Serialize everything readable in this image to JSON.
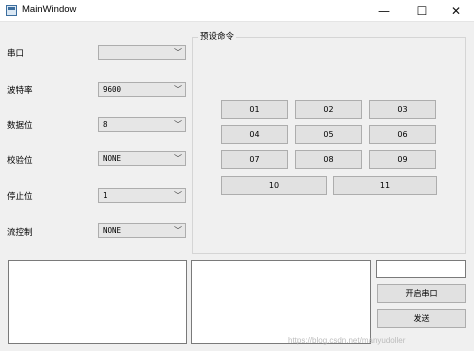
{
  "window": {
    "title": "MainWindow",
    "minimize_glyph": "—",
    "maximize_glyph": "☐",
    "close_glyph": "✕"
  },
  "settings": {
    "port_label": "串口",
    "port_value": "",
    "baud_label": "波特率",
    "baud_value": "9600",
    "databits_label": "数据位",
    "databits_value": "8",
    "parity_label": "校验位",
    "parity_value": "NONE",
    "stopbits_label": "停止位",
    "stopbits_value": "1",
    "flow_label": "流控制",
    "flow_value": "NONE",
    "dropdown_glyph": "﹀"
  },
  "presets": {
    "title": "预设命令",
    "buttons": [
      "01",
      "02",
      "03",
      "04",
      "05",
      "06",
      "07",
      "08",
      "09",
      "10",
      "11"
    ]
  },
  "actions": {
    "send_input_value": "",
    "open_port_label": "开启串口",
    "send_label": "发送"
  },
  "watermark": "https://blog.csdn.net/manyudoller",
  "icons": {
    "app": "window-app-icon",
    "dropdown": "chevron-down-icon"
  }
}
